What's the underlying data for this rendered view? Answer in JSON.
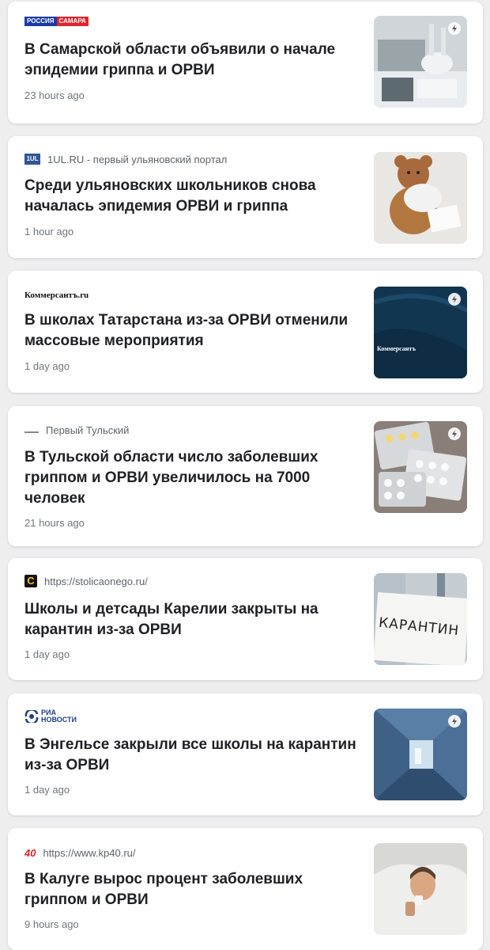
{
  "articles": [
    {
      "source_logo": {
        "left": "РОССИЯ",
        "right": "САМАРА"
      },
      "source_name": "",
      "headline": "В Самарской области объявили о начале эпидемии гриппа и ОРВИ",
      "time": "23 hours ago",
      "thumbnail": "lab-test-tubes-image"
    },
    {
      "source_logo": "1UL",
      "source_name": "1UL.RU - первый ульяновский портал",
      "headline": "Среди ульяновских школьников снова началась эпидемия ОРВИ и гриппа",
      "time": "1 hour ago",
      "thumbnail": "teddy-bear-with-tissues-image"
    },
    {
      "source_logo": "Коммерсантъ.ru",
      "source_name": "",
      "headline": "В школах Татарстана из-за ОРВИ отменили массовые мероприятия",
      "time": "1 day ago",
      "thumbnail": "kommersant-placeholder-image",
      "thumbnail_text": "Коммерсантъ"
    },
    {
      "source_logo": "tula-logo",
      "source_name": "Первый Тульский",
      "headline": "В Тульской области число заболевших гриппом и ОРВИ увеличилось на 7000 человек",
      "time": "21 hours ago",
      "thumbnail": "pill-blister-packs-image"
    },
    {
      "source_logo": "C",
      "source_name": "https://stolicaonego.ru/",
      "headline": "Школы и детсады Карелии закрыты на карантин из-за ОРВИ",
      "time": "1 day ago",
      "thumbnail": "quarantine-sign-image",
      "thumbnail_text": "КАРАНТИН"
    },
    {
      "source_logo": {
        "top": "РИА",
        "bottom": "НОВОСТИ"
      },
      "source_name": "",
      "headline": "В Энгельсе закрыли все школы на карантин из-за ОРВИ",
      "time": "1 day ago",
      "thumbnail": "school-corridor-image"
    },
    {
      "source_logo": "40",
      "source_name": "https://www.kp40.ru/",
      "headline": "В Калуге вырос процент заболевших гриппом и ОРВИ",
      "time": "9 hours ago",
      "thumbnail": "sick-man-in-blanket-image"
    }
  ],
  "colors": {
    "background": "#eeeeef",
    "card": "#ffffff",
    "headline": "#202124",
    "meta": "#70757a"
  }
}
